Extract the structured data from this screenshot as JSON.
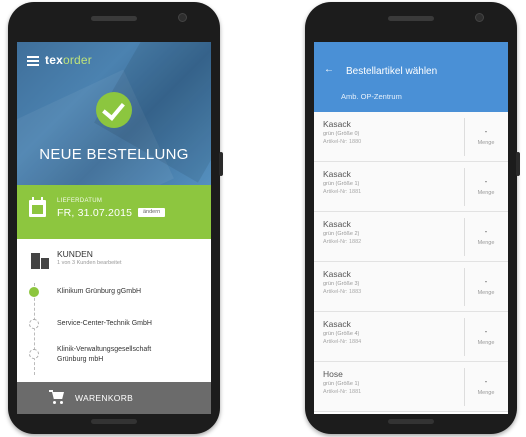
{
  "left": {
    "logo": {
      "part1": "tex",
      "part2": "order"
    },
    "hero_title": "NEUE BESTELLUNG",
    "delivery": {
      "label": "LIEFERDATUM",
      "value": "FR, 31.07.2015",
      "change": "ändern"
    },
    "clients": {
      "title": "KUNDEN",
      "subtitle": "1 von 3 Kunden bearbeitet",
      "items": [
        {
          "line1": "Klinikum Grünburg gGmbH",
          "line2": ""
        },
        {
          "line1": "Service-Center-Technik GmbH",
          "line2": ""
        },
        {
          "line1": "Klinik-Verwaltungsgesellschaft",
          "line2": "Grünburg mbH"
        }
      ]
    },
    "cart": {
      "label": "WARENKORB"
    }
  },
  "right": {
    "title": "Bestellartikel wählen",
    "subtitle": "Amb. OP-Zentrum",
    "items": [
      {
        "name": "Kasack",
        "variant": "grün (Größe 0)",
        "artno": "Artikel-Nr: 1880",
        "qty": "-",
        "qty_label": "Menge"
      },
      {
        "name": "Kasack",
        "variant": "grün (Größe 1)",
        "artno": "Artikel-Nr: 1881",
        "qty": "-",
        "qty_label": "Menge"
      },
      {
        "name": "Kasack",
        "variant": "grün (Größe 2)",
        "artno": "Artikel-Nr: 1882",
        "qty": "-",
        "qty_label": "Menge"
      },
      {
        "name": "Kasack",
        "variant": "grün (Größe 3)",
        "artno": "Artikel-Nr: 1883",
        "qty": "-",
        "qty_label": "Menge"
      },
      {
        "name": "Kasack",
        "variant": "grün (Größe 4)",
        "artno": "Artikel-Nr: 1884",
        "qty": "-",
        "qty_label": "Menge"
      },
      {
        "name": "Hose",
        "variant": "grün (Größe 1)",
        "artno": "Artikel-Nr: 1881",
        "qty": "-",
        "qty_label": "Menge"
      }
    ]
  },
  "colors": {
    "accent_green": "#8dc63f",
    "header_blue": "#4a90d6",
    "cart_gray": "#6b6b6b"
  }
}
